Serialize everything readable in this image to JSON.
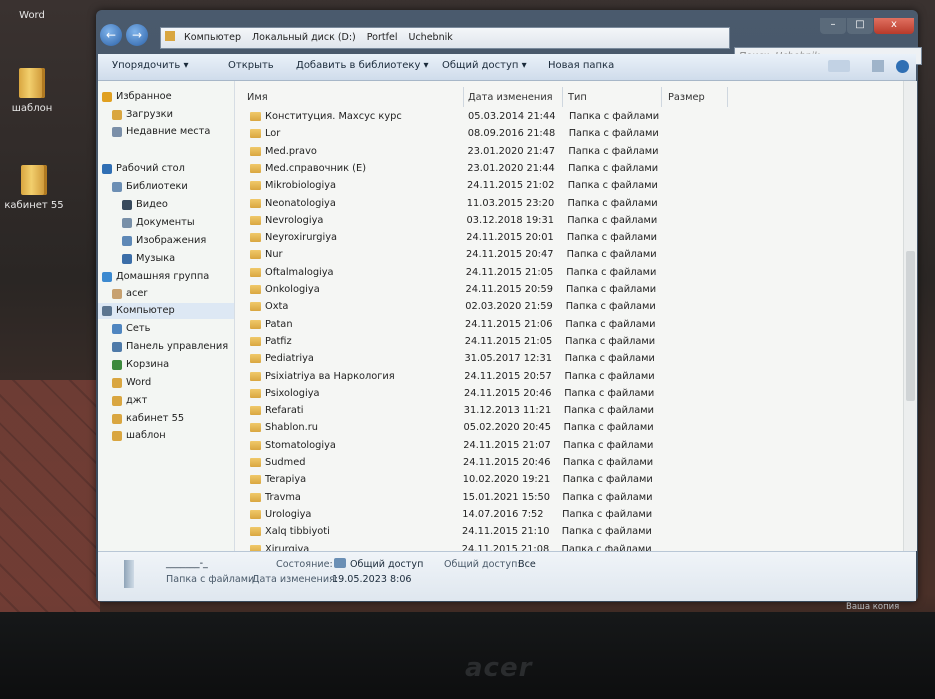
{
  "desktop": {
    "icons": [
      {
        "label": "Word",
        "icon": "word-icon"
      },
      {
        "label": "шаблон",
        "icon": "folder-icon"
      },
      {
        "label": "кабинет 55",
        "icon": "folder-icon"
      }
    ],
    "watermark": "Ваша копия Windows"
  },
  "window": {
    "controls": {
      "minimize": "–",
      "maximize": "□",
      "close": "x"
    },
    "back": "←",
    "forward": "→",
    "breadcrumb": [
      "Компьютер",
      "Локальный диск (D:)",
      "Portfel",
      "Uchebnik"
    ],
    "search_placeholder": "Поиск: Uchebnik"
  },
  "toolbar": {
    "organize": "Упорядочить ▾",
    "open": "Открыть",
    "add_to_library": "Добавить в библиотеку ▾",
    "share": "Общий доступ ▾",
    "new_folder": "Новая папка"
  },
  "nav_pane": {
    "items": [
      {
        "label": "Избранное",
        "icon": "star-icon"
      },
      {
        "label": "Загрузки",
        "icon": "downloads-icon"
      },
      {
        "label": "Недавние места",
        "icon": "recent-places-icon"
      },
      {
        "label": "Рабочий стол",
        "icon": "desktop-icon"
      },
      {
        "label": "Библиотеки",
        "icon": "libraries-icon"
      },
      {
        "label": "Видео",
        "icon": "video-icon"
      },
      {
        "label": "Документы",
        "icon": "documents-icon"
      },
      {
        "label": "Изображения",
        "icon": "pictures-icon"
      },
      {
        "label": "Музыка",
        "icon": "music-icon"
      },
      {
        "label": "Домашняя группа",
        "icon": "homegroup-icon"
      },
      {
        "label": "acer",
        "icon": "user-icon"
      },
      {
        "label": "Компьютер",
        "icon": "computer-icon"
      },
      {
        "label": "Сеть",
        "icon": "network-icon"
      },
      {
        "label": "Панель управления",
        "icon": "control-panel-icon"
      },
      {
        "label": "Корзина",
        "icon": "recycle-bin-icon"
      },
      {
        "label": "Word",
        "icon": "folder-icon"
      },
      {
        "label": "джт",
        "icon": "folder-icon"
      },
      {
        "label": "кабинет 55",
        "icon": "folder-icon"
      },
      {
        "label": "шаблон",
        "icon": "folder-icon"
      }
    ]
  },
  "file_list": {
    "columns": [
      "Имя",
      "Дата изменения",
      "Тип",
      "Размер"
    ],
    "rows": [
      {
        "name": "Конституция. Махсус курс",
        "date": "05.03.2014 21:44",
        "type": "Папка с файлами"
      },
      {
        "name": "Lor",
        "date": "08.09.2016 21:48",
        "type": "Папка с файлами"
      },
      {
        "name": "Med.pravo",
        "date": "23.01.2020 21:47",
        "type": "Папка с файлами"
      },
      {
        "name": "Med.справочник (E)",
        "date": "23.01.2020 21:44",
        "type": "Папка с файлами"
      },
      {
        "name": "Mikrobiologiya",
        "date": "24.11.2015 21:02",
        "type": "Папка с файлами"
      },
      {
        "name": "Neonatologiya",
        "date": "11.03.2015 23:20",
        "type": "Папка с файлами"
      },
      {
        "name": "Nevrologiya",
        "date": "03.12.2018 19:31",
        "type": "Папка с файлами"
      },
      {
        "name": "Neyroxirurgiya",
        "date": "24.11.2015 20:01",
        "type": "Папка с файлами"
      },
      {
        "name": "Nur",
        "date": "24.11.2015 20:47",
        "type": "Папка с файлами"
      },
      {
        "name": "Oftalmalogiya",
        "date": "24.11.2015 21:05",
        "type": "Папка с файлами"
      },
      {
        "name": "Onkologiya",
        "date": "24.11.2015 20:59",
        "type": "Папка с файлами"
      },
      {
        "name": "Oxta",
        "date": "02.03.2020 21:59",
        "type": "Папка с файлами"
      },
      {
        "name": "Patan",
        "date": "24.11.2015 21:06",
        "type": "Папка с файлами"
      },
      {
        "name": "Patfiz",
        "date": "24.11.2015 21:05",
        "type": "Папка с файлами"
      },
      {
        "name": "Pediatriya",
        "date": "31.05.2017 12:31",
        "type": "Папка с файлами"
      },
      {
        "name": "Psixiatriya ва Наркология",
        "date": "24.11.2015 20:57",
        "type": "Папка с файлами"
      },
      {
        "name": "Psixologiya",
        "date": "24.11.2015 20:46",
        "type": "Папка с файлами"
      },
      {
        "name": "Refarati",
        "date": "31.12.2013 11:21",
        "type": "Папка с файлами"
      },
      {
        "name": "Shablon.ru",
        "date": "05.02.2020 20:45",
        "type": "Папка с файлами"
      },
      {
        "name": "Stomatologiya",
        "date": "24.11.2015 21:07",
        "type": "Папка с файлами"
      },
      {
        "name": "Sudmed",
        "date": "24.11.2015 20:46",
        "type": "Папка с файлами"
      },
      {
        "name": "Terapiya",
        "date": "10.02.2020 19:21",
        "type": "Папка с файлами"
      },
      {
        "name": "Travma",
        "date": "15.01.2021 15:50",
        "type": "Папка с файлами"
      },
      {
        "name": "Urologiya",
        "date": "14.07.2016 7:52",
        "type": "Папка с файлами"
      },
      {
        "name": "Xalq tibbiyoti",
        "date": "24.11.2015 21:10",
        "type": "Папка с файлами"
      },
      {
        "name": "Xirurgiya",
        "date": "24.11.2015 21:08",
        "type": "Папка с файлами"
      }
    ]
  },
  "details": {
    "name": "_______-_",
    "type": "Папка с файлами",
    "state_label": "Состояние:",
    "state_value": "Общий доступ",
    "shared_label": "Общий доступ:",
    "shared_value": "Все",
    "modified_label": "Дата изменения:",
    "modified_value": "19.05.2023 8:06"
  },
  "bezel": {
    "brand": "acer"
  }
}
